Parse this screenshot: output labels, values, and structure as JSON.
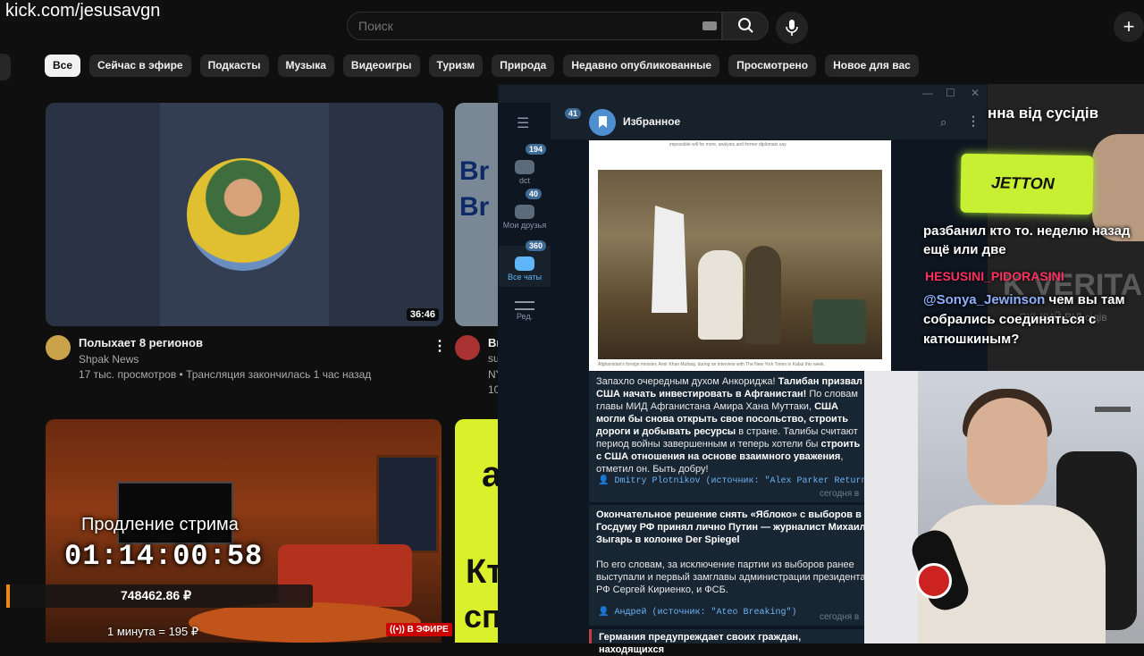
{
  "overlay": {
    "stream_url": "kick.com/jesusavgn"
  },
  "youtube": {
    "search_placeholder": "Поиск",
    "create_icon": "+",
    "chips": [
      "Все",
      "Сейчас в эфире",
      "Подкасты",
      "Музыка",
      "Видеоигры",
      "Туризм",
      "Природа",
      "Недавно опубликованные",
      "Просмотрено",
      "Новое для вас"
    ],
    "video1": {
      "duration": "36:46",
      "title": "Полыхает 8 регионов",
      "channel": "Shpak News",
      "meta": "17 тыс. просмотров • Трансляция закончилась 1 час назад"
    },
    "video2": {
      "title": "Br",
      "meta_a": "su",
      "meta_b": "NY",
      "meta_c": "10",
      "thumb_text": "Br"
    },
    "stream_card": {
      "extend_label": "Продление стрима",
      "timer": "01:14:00:58",
      "donation_total": "748462.86 ₽",
      "rate": "1 минута = 195 ₽",
      "live_badge": "В ЭФИРЕ"
    },
    "green_card": {
      "text_a": "Кт",
      "text_b": "сп",
      "text_c": "а"
    }
  },
  "telegram": {
    "chat_title": "Избранное",
    "back_badge": "41",
    "folders": [
      {
        "label": "dct",
        "count": "194"
      },
      {
        "label": "Мои друзья",
        "count": "40"
      },
      {
        "label": "Все чаты",
        "count": "360"
      },
      {
        "label": "Ред.",
        "count": ""
      }
    ],
    "image_caption_top": "impossible will for more, analysts and former diplomats say.",
    "image_caption_bottom": "Afghanistan's foreign minister, Amir Khan Muttaqi, during an interview with The New York Times in Kabul this week.",
    "messages": [
      {
        "text_parts": [
          "Запахло очередным духом Анкориджа! ",
          "Талибан призвал США начать инвестировать в Афганистан!",
          " По словам главы МИД Афганистана Амира Хана Муттаки, ",
          "США могли бы снова открыть свое посольство, строить дороги и добывать ресурсы",
          " в стране. Талибы считают период войны завершенным и теперь хотели бы ",
          "строить с США отношения на основе взаимного уважения",
          ", отметил он. Быть добру!"
        ],
        "source": "👤 Dmitry Plotnikov (источник: \"Alex Parker Returns\")",
        "time": "сегодня в"
      },
      {
        "headline": "Окончательное решение снять «Яблоко» с выборов в Госдуму РФ принял лично Путин — журналист Михаил Зыгарь в колонке Der Spiegel",
        "body": "По его словам, за исключение партии из выборов ранее выступали и первый замглавы администрации президента РФ Сергей Кириенко, и ФСБ.",
        "source": "👤 Андрей (источник: \"Ateo Breaking\")",
        "time": "сегодня в"
      },
      {
        "headline": "Германия предупреждает своих граждан, находящихся"
      }
    ]
  },
  "stream_overlay": {
    "top_ticker": "нна від сусідів",
    "sponsor": "JETTON",
    "chat_line1": "разбанил кто то. неделю назад ещё или две",
    "chat_user1": "HESUSINI_PIDORASINI",
    "chat_mention": "@Sonya_Jewinson",
    "chat_line2": " чем вы там собрались соединяться с катюшкиным?",
    "ghost_text1": "K VERITA",
    "ghost_text2": "СКЬКИЙ ВІД   сідів"
  },
  "icons": {
    "search": "search-icon",
    "mic": "microphone-icon",
    "keyboard": "keyboard-icon",
    "more": "more-vert-icon",
    "hamburger": "hamburger-icon"
  }
}
